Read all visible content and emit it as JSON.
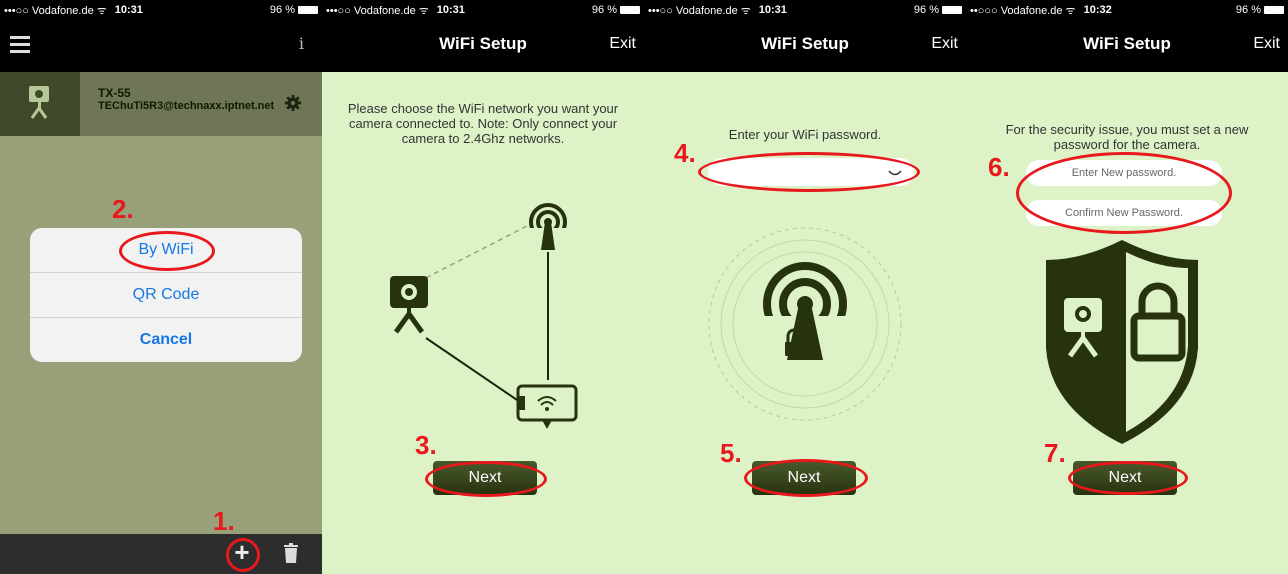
{
  "screens": [
    {
      "status": {
        "carrier": "•••○○ Vodafone.de ᯤ",
        "time": "10:31",
        "battery": "96 %"
      },
      "info_label": "i",
      "device": {
        "name": "TX-55",
        "id": "TEChuTi5R3@technaxx.iptnet.net"
      },
      "sheet": {
        "options": [
          "By WiFi",
          "QR Code",
          "Cancel"
        ]
      },
      "tabbar": {
        "add": "+"
      },
      "step_marks": [
        "1.",
        "2."
      ]
    },
    {
      "status": {
        "carrier": "•••○○ Vodafone.de ᯤ",
        "time": "10:31",
        "battery": "96 %"
      },
      "title": "WiFi Setup",
      "exit": "Exit",
      "instruction": "Please choose the WiFi network you want your camera connected to. Note: Only connect your camera to 2.4Ghz networks.",
      "next": "Next",
      "step_marks": [
        "3."
      ]
    },
    {
      "status": {
        "carrier": "•••○○ Vodafone.de ᯤ",
        "time": "10:31",
        "battery": "96 %"
      },
      "title": "WiFi Setup",
      "exit": "Exit",
      "instruction": "Enter your WiFi password.",
      "next": "Next",
      "step_marks": [
        "4.",
        "5."
      ]
    },
    {
      "status": {
        "carrier": "••○○○ Vodafone.de ᯤ",
        "time": "10:32",
        "battery": "96 %"
      },
      "title": "WiFi Setup",
      "exit": "Exit",
      "instruction": "For the security issue, you must set a new password for the camera.",
      "new_password_placeholder": "Enter New password.",
      "confirm_password_placeholder": "Confirm New Password.",
      "next": "Next",
      "step_marks": [
        "6.",
        "7."
      ]
    }
  ],
  "colors": {
    "accent": "#1877e6",
    "annotation": "#e8181c",
    "panel": "#ddf3c7",
    "dark_olive": "#27320f"
  }
}
